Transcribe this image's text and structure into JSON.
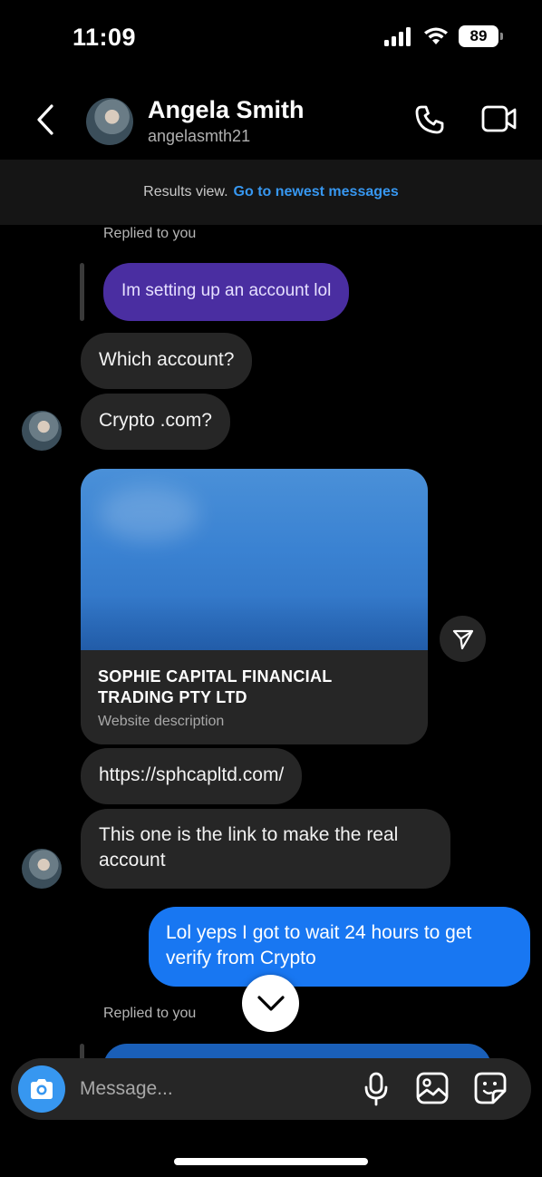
{
  "status_bar": {
    "time": "11:09",
    "battery": "89"
  },
  "header": {
    "name": "Angela Smith",
    "username": "angelasmth21"
  },
  "banner": {
    "text": "Results view.",
    "link": "Go to newest messages"
  },
  "messages": {
    "reply_label_1": "Replied to you",
    "purple_reply": "Im setting up an account lol",
    "m1": "Which account?",
    "m2": "Crypto .com?",
    "card": {
      "title": "SOPHIE CAPITAL FINANCIAL TRADING PTY LTD",
      "description": "Website description"
    },
    "m3": "https://sphcapltd.com/",
    "m4": "This one is the link to make the real account",
    "m5": "Lol yeps I got to wait 24 hours to get verify from Crypto",
    "reply_label_2": "Replied to you"
  },
  "composer": {
    "placeholder": "Message..."
  },
  "colors": {
    "accent": "#3797f0",
    "sent_bubble": "#1877f2",
    "reply_bubble": "#4a2ea1",
    "received_bubble": "#262626"
  },
  "icons": [
    "chevron-left-icon",
    "phone-icon",
    "video-icon",
    "send-icon",
    "chevron-down-icon",
    "camera-icon",
    "microphone-icon",
    "image-icon",
    "sticker-icon"
  ]
}
